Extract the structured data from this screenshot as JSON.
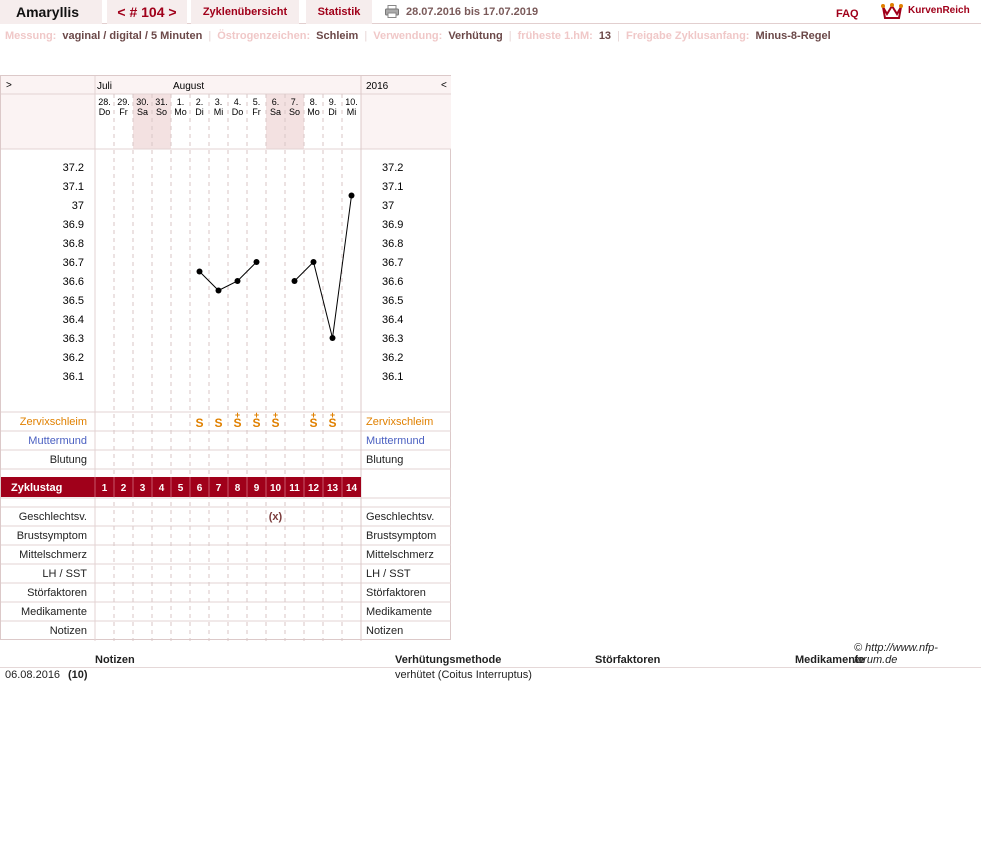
{
  "header": {
    "user": "Amaryllis",
    "cycle": "< # 104 >",
    "tab_overview": "Zyklenübersicht",
    "tab_stats": "Statistik",
    "date_range": "28.07.2016 bis 17.07.2019",
    "faq": "FAQ",
    "brand": "KurvenReich"
  },
  "info": {
    "messung_label": "Messung:",
    "messung": "vaginal / digital / 5 Minuten",
    "oestrogen_label": "Östrogenzeichen:",
    "oestrogen": "Schleim",
    "verwendung_label": "Verwendung:",
    "verwendung": "Verhütung",
    "hm_label": "früheste 1.hM:",
    "hm": "13",
    "freigabe_label": "Freigabe Zyklusanfang:",
    "freigabe": "Minus-8-Regel"
  },
  "chart_nav": {
    "prev": ">",
    "next": "<",
    "year": "2016",
    "month1": "Juli",
    "month2": "August"
  },
  "days": [
    {
      "d": "28.",
      "w": "Do",
      "weekend": false
    },
    {
      "d": "29.",
      "w": "Fr",
      "weekend": false
    },
    {
      "d": "30.",
      "w": "Sa",
      "weekend": true
    },
    {
      "d": "31.",
      "w": "So",
      "weekend": true
    },
    {
      "d": "1.",
      "w": "Mo",
      "weekend": false
    },
    {
      "d": "2.",
      "w": "Di",
      "weekend": false
    },
    {
      "d": "3.",
      "w": "Mi",
      "weekend": false
    },
    {
      "d": "4.",
      "w": "Do",
      "weekend": false
    },
    {
      "d": "5.",
      "w": "Fr",
      "weekend": false
    },
    {
      "d": "6.",
      "w": "Sa",
      "weekend": true
    },
    {
      "d": "7.",
      "w": "So",
      "weekend": true
    },
    {
      "d": "8.",
      "w": "Mo",
      "weekend": false
    },
    {
      "d": "9.",
      "w": "Di",
      "weekend": false
    },
    {
      "d": "10.",
      "w": "Mi",
      "weekend": false
    }
  ],
  "chart_data": {
    "type": "line",
    "y_ticks": [
      "37.2",
      "37.1",
      "37",
      "36.9",
      "36.8",
      "36.7",
      "36.6",
      "36.5",
      "36.4",
      "36.3",
      "36.2",
      "36.1"
    ],
    "ylim": [
      36.1,
      37.2
    ],
    "zyklustag": [
      "1",
      "2",
      "3",
      "4",
      "5",
      "6",
      "7",
      "8",
      "9",
      "10",
      "11",
      "12",
      "13",
      "14"
    ],
    "temperatures": [
      null,
      null,
      null,
      null,
      null,
      36.65,
      36.55,
      36.6,
      36.7,
      null,
      36.6,
      36.7,
      36.3,
      37.05
    ],
    "segments": [
      [
        6,
        7,
        8,
        9
      ],
      [
        11,
        12,
        13,
        14
      ]
    ],
    "cervix": [
      "",
      "",
      "",
      "",
      "",
      "S",
      "S",
      "S+",
      "S+",
      "S+",
      "",
      "S+",
      "S+",
      ""
    ],
    "intercourse_day": 10,
    "intercourse_symbol": "(x)"
  },
  "rows": {
    "zervix": "Zervixschleim",
    "muttermund": "Muttermund",
    "blutung": "Blutung",
    "zyklustag": "Zyklustag",
    "gv": "Geschlechtsv.",
    "brust": "Brustsymptom",
    "mittel": "Mittelschmerz",
    "lh": "LH / SST",
    "stoer": "Störfaktoren",
    "medi": "Medikamente",
    "notizen": "Notizen"
  },
  "colors": {
    "accent": "#a0001a",
    "zervix": "#e08000",
    "muttermund": "#4a5fc1",
    "weekend": "#f3e1e1"
  },
  "footer": {
    "source": "© http://www.nfp-forum.de",
    "col_notizen": "Notizen",
    "col_methode": "Verhütungsmethode",
    "col_stoer": "Störfaktoren",
    "col_medi": "Medikamente",
    "row_date": "06.08.2016",
    "row_day": "(10)",
    "row_method": "verhütet (Coitus Interruptus)"
  }
}
